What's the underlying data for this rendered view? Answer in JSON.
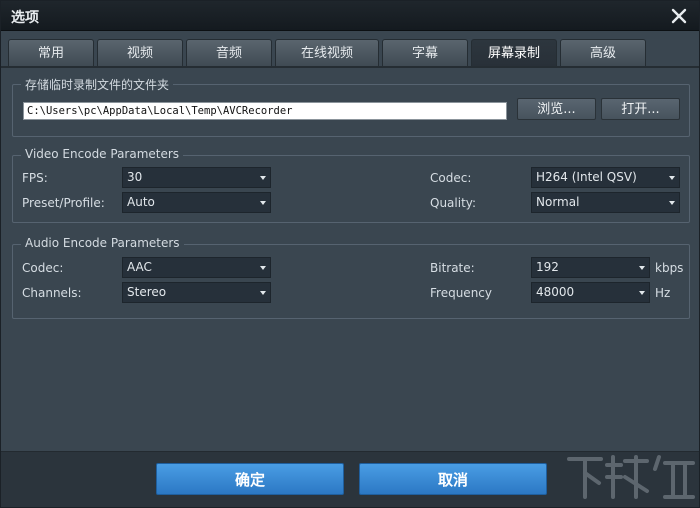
{
  "window": {
    "title": "选项"
  },
  "tabs": [
    {
      "label": "常用",
      "active": false
    },
    {
      "label": "视频",
      "active": false
    },
    {
      "label": "音频",
      "active": false
    },
    {
      "label": "在线视频",
      "active": false
    },
    {
      "label": "字幕",
      "active": false
    },
    {
      "label": "屏幕录制",
      "active": true
    },
    {
      "label": "高级",
      "active": false
    }
  ],
  "temp_folder": {
    "title": "存储临时录制文件的文件夹",
    "path": "C:\\Users\\pc\\AppData\\Local\\Temp\\AVCRecorder",
    "browse_label": "浏览...",
    "open_label": "打开..."
  },
  "video": {
    "title": "Video Encode Parameters",
    "fps_label": "FPS:",
    "fps_value": "30",
    "preset_label": "Preset/Profile:",
    "preset_value": "Auto",
    "codec_label": "Codec:",
    "codec_value": "H264 (Intel QSV)",
    "quality_label": "Quality:",
    "quality_value": "Normal"
  },
  "audio": {
    "title": "Audio Encode Parameters",
    "codec_label": "Codec:",
    "codec_value": "AAC",
    "channels_label": "Channels:",
    "channels_value": "Stereo",
    "bitrate_label": "Bitrate:",
    "bitrate_value": "192",
    "bitrate_unit": "kbps",
    "frequency_label": "Frequency",
    "frequency_value": "48000",
    "frequency_unit": "Hz"
  },
  "footer": {
    "ok_label": "确定",
    "cancel_label": "取消"
  },
  "colors": {
    "accent": "#3a8bd6",
    "panel": "#3a4650",
    "titlebar": "#1a2026"
  },
  "icons": {
    "close": "close-icon",
    "dropdown": "chevron-down-icon"
  }
}
